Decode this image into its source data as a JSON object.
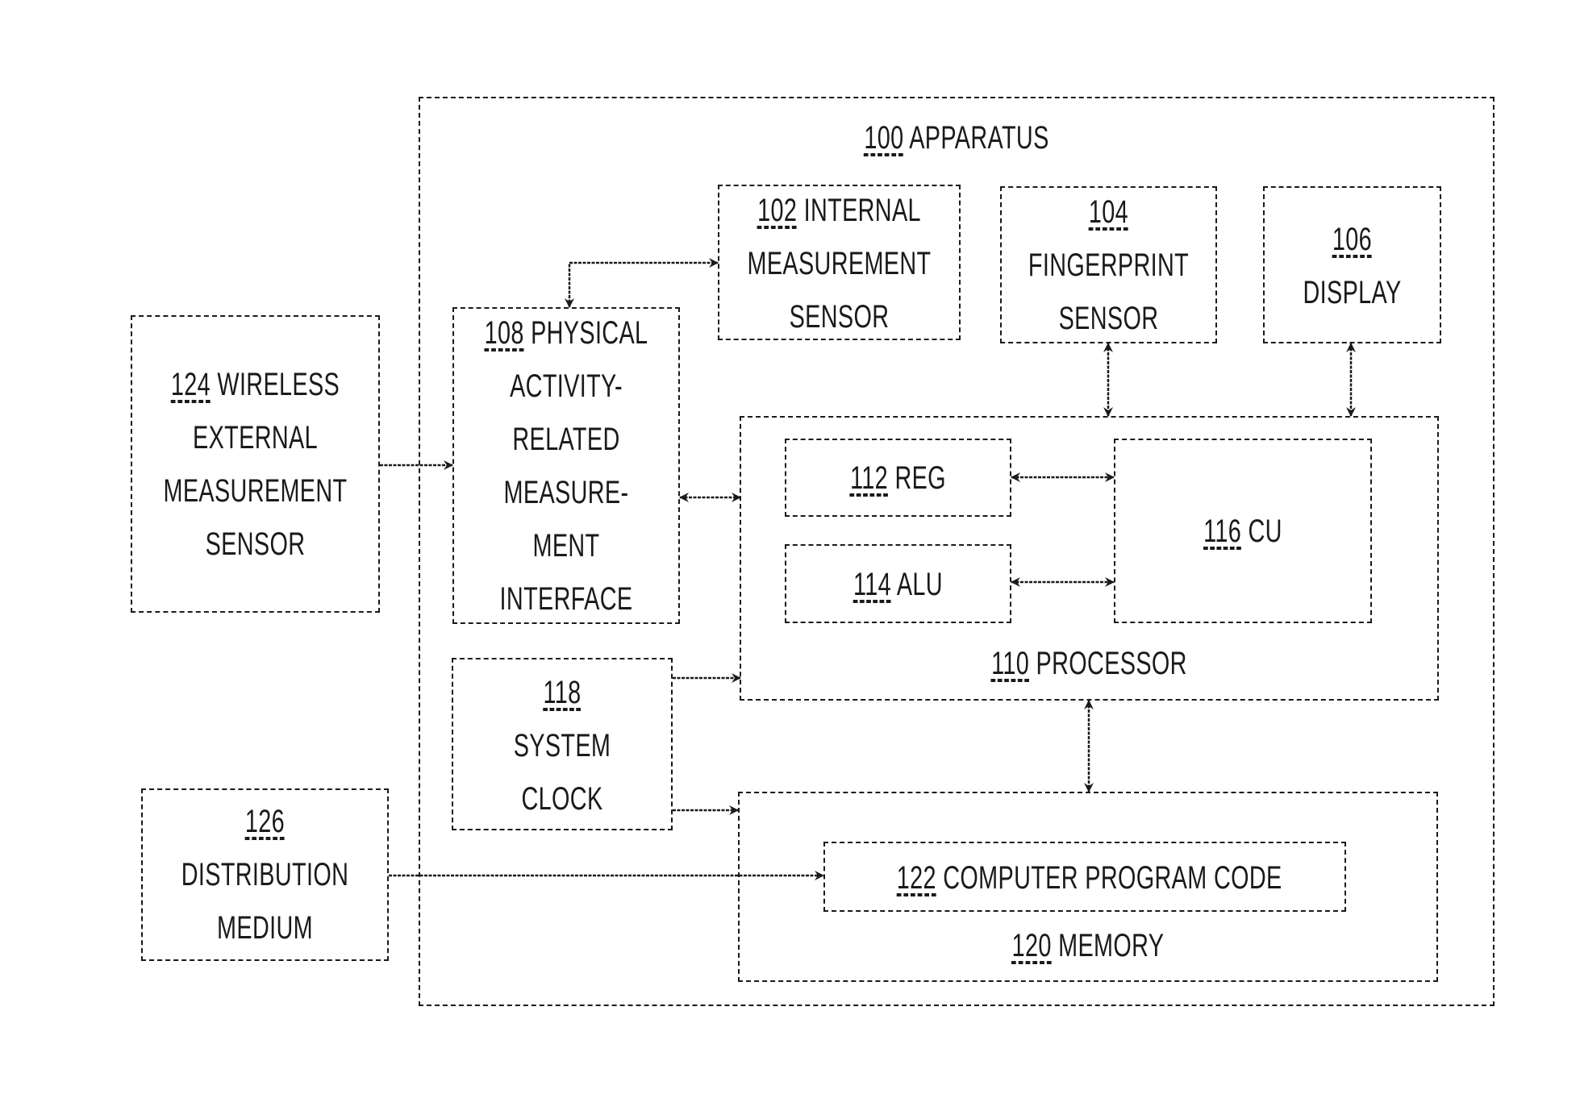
{
  "figure": {
    "blocks": {
      "apparatus": {
        "ref": "100",
        "text": "APPARATUS"
      },
      "internal_sensor": {
        "ref": "102",
        "line1": "INTERNAL",
        "line2": "MEASUREMENT",
        "line3": "SENSOR"
      },
      "fingerprint_sensor": {
        "ref": "104",
        "line1": "FINGERPRINT",
        "line2": "SENSOR"
      },
      "display": {
        "ref": "106",
        "line1": "DISPLAY"
      },
      "interface": {
        "ref": "108",
        "line1": "PHYSICAL",
        "line2": "ACTIVITY-",
        "line3": "RELATED",
        "line4": "MEASURE-",
        "line5": "MENT",
        "line6": "INTERFACE"
      },
      "processor": {
        "ref": "110",
        "text": "PROCESSOR"
      },
      "reg": {
        "ref": "112",
        "text": "REG"
      },
      "alu": {
        "ref": "114",
        "text": "ALU"
      },
      "cu": {
        "ref": "116",
        "text": "CU"
      },
      "clock": {
        "ref": "118",
        "line1": "SYSTEM",
        "line2": "CLOCK"
      },
      "memory": {
        "ref": "120",
        "text": "MEMORY"
      },
      "program_code": {
        "ref": "122",
        "text": "COMPUTER PROGRAM CODE"
      },
      "wireless_sensor": {
        "ref": "124",
        "line1": "WIRELESS",
        "line2": "EXTERNAL",
        "line3": "MEASUREMENT",
        "line4": "SENSOR"
      },
      "distribution_medium": {
        "ref": "126",
        "line1": "DISTRIBUTION",
        "line2": "MEDIUM"
      }
    },
    "connections": [
      {
        "from": "108",
        "to": "102",
        "type": "bidirectional"
      },
      {
        "from": "124",
        "to": "108",
        "type": "unidirectional"
      },
      {
        "from": "108",
        "to": "110",
        "type": "bidirectional"
      },
      {
        "from": "104",
        "to": "110",
        "type": "bidirectional"
      },
      {
        "from": "106",
        "to": "110",
        "type": "bidirectional"
      },
      {
        "from": "112",
        "to": "116",
        "type": "bidirectional"
      },
      {
        "from": "114",
        "to": "116",
        "type": "bidirectional"
      },
      {
        "from": "118",
        "to": "110",
        "type": "unidirectional"
      },
      {
        "from": "118",
        "to": "120",
        "type": "unidirectional"
      },
      {
        "from": "110",
        "to": "120",
        "type": "bidirectional"
      },
      {
        "from": "126",
        "to": "122",
        "type": "unidirectional"
      }
    ]
  }
}
